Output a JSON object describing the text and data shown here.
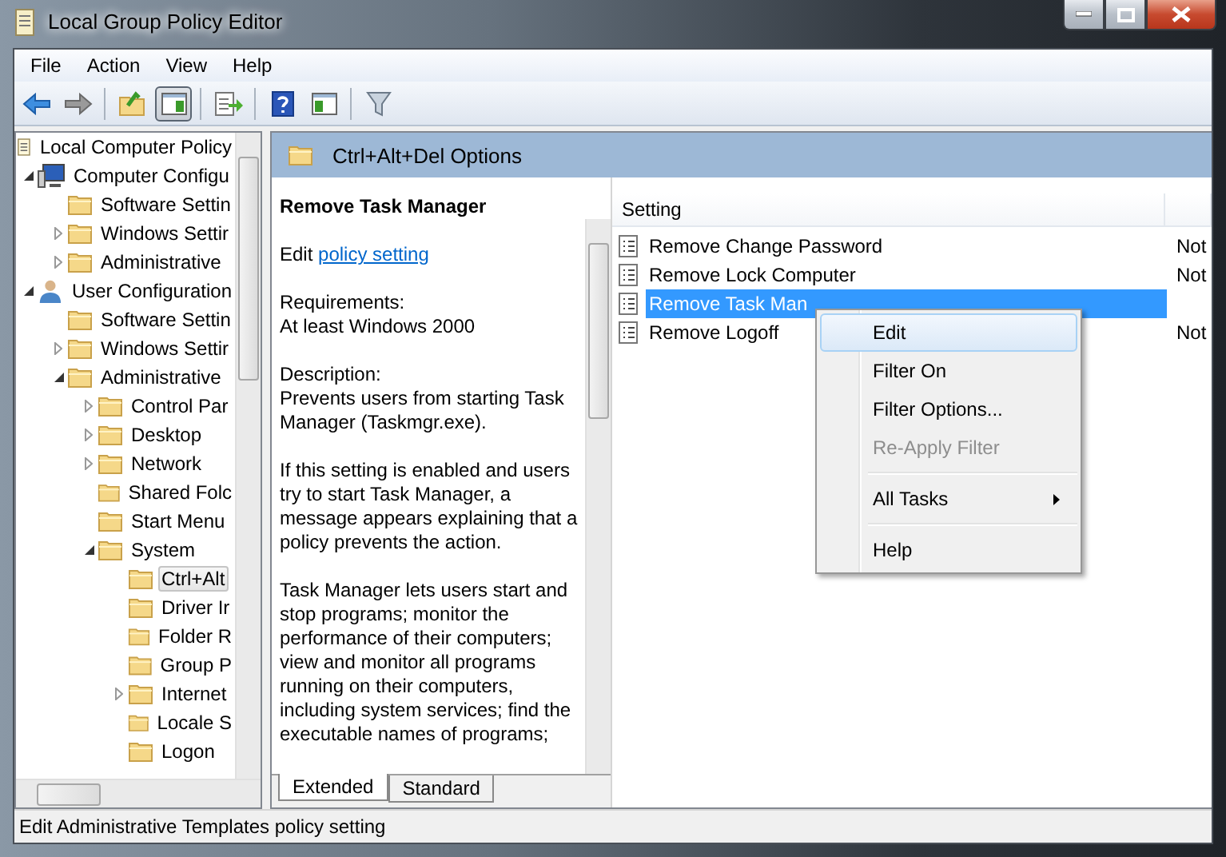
{
  "window": {
    "title": "Local Group Policy Editor"
  },
  "menu": [
    "File",
    "Action",
    "View",
    "Help"
  ],
  "toolbar": [
    {
      "kind": "back",
      "pressed": false
    },
    {
      "kind": "forward",
      "pressed": false
    },
    {
      "kind": "sep"
    },
    {
      "kind": "up",
      "pressed": false
    },
    {
      "kind": "tree",
      "pressed": true
    },
    {
      "kind": "sep"
    },
    {
      "kind": "export",
      "pressed": false
    },
    {
      "kind": "sep"
    },
    {
      "kind": "help",
      "pressed": false
    },
    {
      "kind": "action",
      "pressed": false
    },
    {
      "kind": "sep"
    },
    {
      "kind": "filter",
      "pressed": false
    }
  ],
  "tree": [
    {
      "label": "Local Computer Policy",
      "kind": "policy",
      "selected": false,
      "children": [
        {
          "label": "Computer Configu",
          "kind": "computer",
          "expanded": true,
          "selected": false,
          "children": [
            {
              "label": "Software Settin",
              "kind": "folder",
              "selected": false
            },
            {
              "label": "Windows Settir",
              "kind": "folder",
              "expanded": false,
              "selected": false
            },
            {
              "label": "Administrative",
              "kind": "folder",
              "expanded": false,
              "selected": false
            }
          ]
        },
        {
          "label": "User Configuration",
          "kind": "user",
          "expanded": true,
          "selected": false,
          "children": [
            {
              "label": "Software Settin",
              "kind": "folder",
              "selected": false
            },
            {
              "label": "Windows Settir",
              "kind": "folder",
              "expanded": false,
              "selected": false
            },
            {
              "label": "Administrative",
              "kind": "folder",
              "expanded": true,
              "selected": false,
              "children": [
                {
                  "label": "Control Par",
                  "kind": "folder",
                  "expanded": false,
                  "selected": false
                },
                {
                  "label": "Desktop",
                  "kind": "folder",
                  "expanded": false,
                  "selected": false
                },
                {
                  "label": "Network",
                  "kind": "folder",
                  "expanded": false,
                  "selected": false
                },
                {
                  "label": "Shared Folc",
                  "kind": "folder",
                  "selected": false
                },
                {
                  "label": "Start Menu",
                  "kind": "folder",
                  "selected": false
                },
                {
                  "label": "System",
                  "kind": "folder",
                  "expanded": true,
                  "selected": false,
                  "children": [
                    {
                      "label": "Ctrl+Alt",
                      "kind": "folder",
                      "selected": true
                    },
                    {
                      "label": "Driver Ir",
                      "kind": "folder",
                      "selected": false
                    },
                    {
                      "label": "Folder R",
                      "kind": "folder",
                      "selected": false
                    },
                    {
                      "label": "Group P",
                      "kind": "folder",
                      "selected": false
                    },
                    {
                      "label": "Internet",
                      "kind": "folder",
                      "expanded": false,
                      "selected": false
                    },
                    {
                      "label": "Locale S",
                      "kind": "folder",
                      "selected": false
                    },
                    {
                      "label": "Logon",
                      "kind": "folder",
                      "selected": false
                    }
                  ]
                }
              ]
            }
          ]
        }
      ]
    }
  ],
  "header": {
    "title": "Ctrl+Alt+Del Options"
  },
  "details": {
    "title": "Remove Task Manager",
    "edit_prefix": "Edit",
    "edit_link": "policy setting",
    "paragraphs": [
      [
        "Requirements:",
        "At least Windows 2000"
      ],
      [
        "Description:",
        "Prevents users from starting Task Manager (Taskmgr.exe)."
      ],
      [
        "If this setting is enabled and users try to start Task Manager, a message appears explaining that a policy prevents the action."
      ],
      [
        "Task Manager lets users start and stop programs; monitor the performance of their computers; view and monitor all programs running on their computers, including system services; find the executable names of programs;"
      ]
    ]
  },
  "tabs": [
    {
      "label": "Extended",
      "selected": true
    },
    {
      "label": "Standard",
      "selected": false
    }
  ],
  "table": {
    "columns": [
      "Setting"
    ],
    "rows": [
      {
        "name": "Remove Change Password",
        "column_2": "Not",
        "selected": false
      },
      {
        "name": "Remove Lock Computer",
        "column_2": "Not",
        "selected": false
      },
      {
        "name": "Remove Task Man",
        "selected": true
      },
      {
        "name": "Remove Logoff",
        "column_2": "Not",
        "selected": false
      }
    ]
  },
  "context_menu": [
    {
      "kind": "item",
      "label": "Edit",
      "selected": true,
      "disabled": false
    },
    {
      "kind": "item",
      "label": "Filter On",
      "selected": false,
      "disabled": false
    },
    {
      "kind": "item",
      "label": "Filter Options...",
      "selected": false,
      "disabled": false
    },
    {
      "kind": "item",
      "label": "Re-Apply Filter",
      "selected": false,
      "disabled": true
    },
    {
      "kind": "separator"
    },
    {
      "kind": "submenu",
      "label": "All Tasks",
      "selected": false,
      "disabled": false
    },
    {
      "kind": "separator"
    },
    {
      "kind": "item",
      "label": "Help",
      "selected": false,
      "disabled": false
    }
  ],
  "status_bar": "Edit Administrative Templates policy setting"
}
